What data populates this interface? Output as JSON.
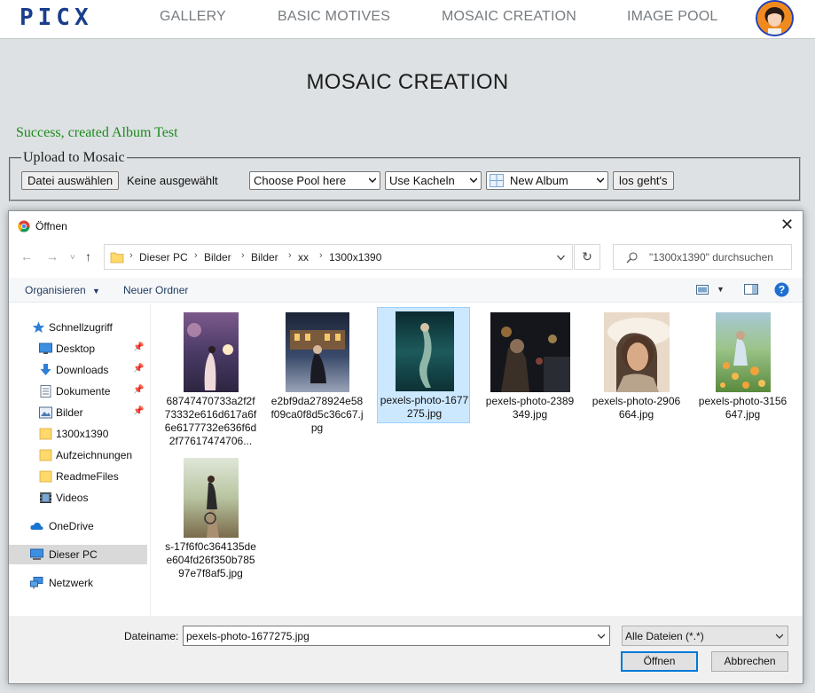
{
  "nav": {
    "logo": "PICX",
    "links": [
      "GALLERY",
      "BASIC MOTIVES",
      "MOSAIC CREATION",
      "IMAGE POOL"
    ],
    "avatar_icon": "user-avatar"
  },
  "page": {
    "title": "MOSAIC CREATION",
    "success_message": "Success, created Album Test",
    "upload": {
      "legend": "Upload to Mosaic",
      "file_button": "Datei auswählen",
      "file_status": "Keine ausgewählt",
      "pool_select": "Choose Pool here",
      "tiles_select": "Use Kacheln",
      "album_select": "New Album",
      "go_button": "los geht's"
    }
  },
  "dialog": {
    "title": "Öffnen",
    "breadcrumb": [
      "Dieser PC",
      "Bilder",
      "Bilder",
      "xx",
      "1300x1390"
    ],
    "search_placeholder": "\"1300x1390\" durchsuchen",
    "toolbar": {
      "organize": "Organisieren",
      "new_folder": "Neuer Ordner"
    },
    "sidebar": [
      {
        "label": "Schnellzugriff",
        "icon": "star-icon",
        "pinned": false
      },
      {
        "label": "Desktop",
        "icon": "desktop-icon",
        "pinned": true
      },
      {
        "label": "Downloads",
        "icon": "download-icon",
        "pinned": true
      },
      {
        "label": "Dokumente",
        "icon": "document-icon",
        "pinned": true
      },
      {
        "label": "Bilder",
        "icon": "pictures-icon",
        "pinned": true
      },
      {
        "label": "1300x1390",
        "icon": "folder-icon",
        "pinned": false
      },
      {
        "label": "Aufzeichnungen",
        "icon": "folder-icon",
        "pinned": false
      },
      {
        "label": "ReadmeFiles",
        "icon": "folder-icon",
        "pinned": false
      },
      {
        "label": "Videos",
        "icon": "video-icon",
        "pinned": false
      },
      {
        "label": "OneDrive",
        "icon": "cloud-icon",
        "pinned": false
      },
      {
        "label": "Dieser PC",
        "icon": "computer-icon",
        "pinned": false,
        "selected": true
      },
      {
        "label": "Netzwerk",
        "icon": "network-icon",
        "pinned": false
      }
    ],
    "files": [
      {
        "name": "68747470733a2f2f73332e616d617a6f6e6177732e636f6d2f77617474706...",
        "selected": false
      },
      {
        "name": "e2bf9da278924e58f09ca0f8d5c36c67.jpg",
        "selected": false
      },
      {
        "name": "pexels-photo-1677275.jpg",
        "selected": true
      },
      {
        "name": "pexels-photo-2389349.jpg",
        "selected": false
      },
      {
        "name": "pexels-photo-2906664.jpg",
        "selected": false
      },
      {
        "name": "pexels-photo-3156647.jpg",
        "selected": false
      },
      {
        "name": "s-17f6f0c364135dee604fd26f350b78597e7f8af5.jpg",
        "selected": false
      }
    ],
    "footer": {
      "filename_label": "Dateiname:",
      "filename_value": "pexels-photo-1677275.jpg",
      "filetype": "Alle Dateien (*.*)",
      "open_button": "Öffnen",
      "cancel_button": "Abbrechen"
    }
  }
}
